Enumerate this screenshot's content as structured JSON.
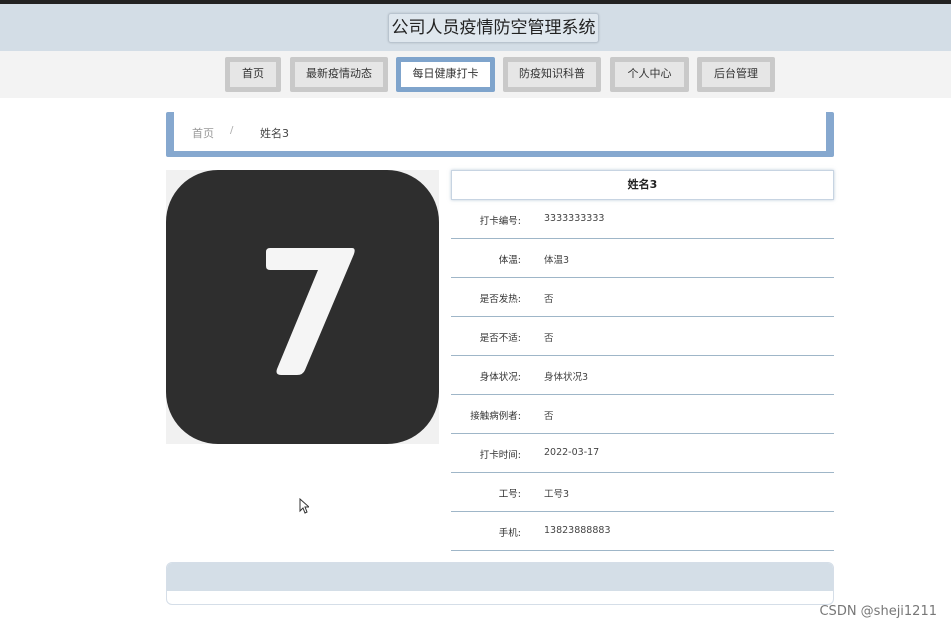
{
  "app": {
    "title": "公司人员疫情防空管理系统"
  },
  "nav": {
    "items": [
      {
        "label": "首页"
      },
      {
        "label": "最新疫情动态"
      },
      {
        "label": "每日健康打卡",
        "active": true
      },
      {
        "label": "防疫知识科普"
      },
      {
        "label": "个人中心"
      },
      {
        "label": "后台管理"
      }
    ]
  },
  "breadcrumb": {
    "home": "首页",
    "separator": "/",
    "current": "姓名3"
  },
  "image": {
    "icon": "rounded-square-seven",
    "text": "7",
    "bg_color": "#2e2e2e",
    "fg_color": "#f5f5f5"
  },
  "detail": {
    "title": "姓名3",
    "rows": [
      {
        "label": "打卡编号:",
        "value": "3333333333"
      },
      {
        "label": "体温:",
        "value": "体温3"
      },
      {
        "label": "是否发热:",
        "value": "否"
      },
      {
        "label": "是否不适:",
        "value": "否"
      },
      {
        "label": "身体状况:",
        "value": "身体状况3"
      },
      {
        "label": "接触病例者:",
        "value": "否"
      },
      {
        "label": "打卡时间:",
        "value": "2022-03-17"
      },
      {
        "label": "工号:",
        "value": "工号3"
      },
      {
        "label": "手机:",
        "value": "13823888883"
      }
    ]
  },
  "watermark": "CSDN @sheji1211",
  "colors": {
    "accent": "#86a8cf",
    "header_bg": "#d3dde6",
    "nav_tab_bg": "#c9c9c9"
  }
}
